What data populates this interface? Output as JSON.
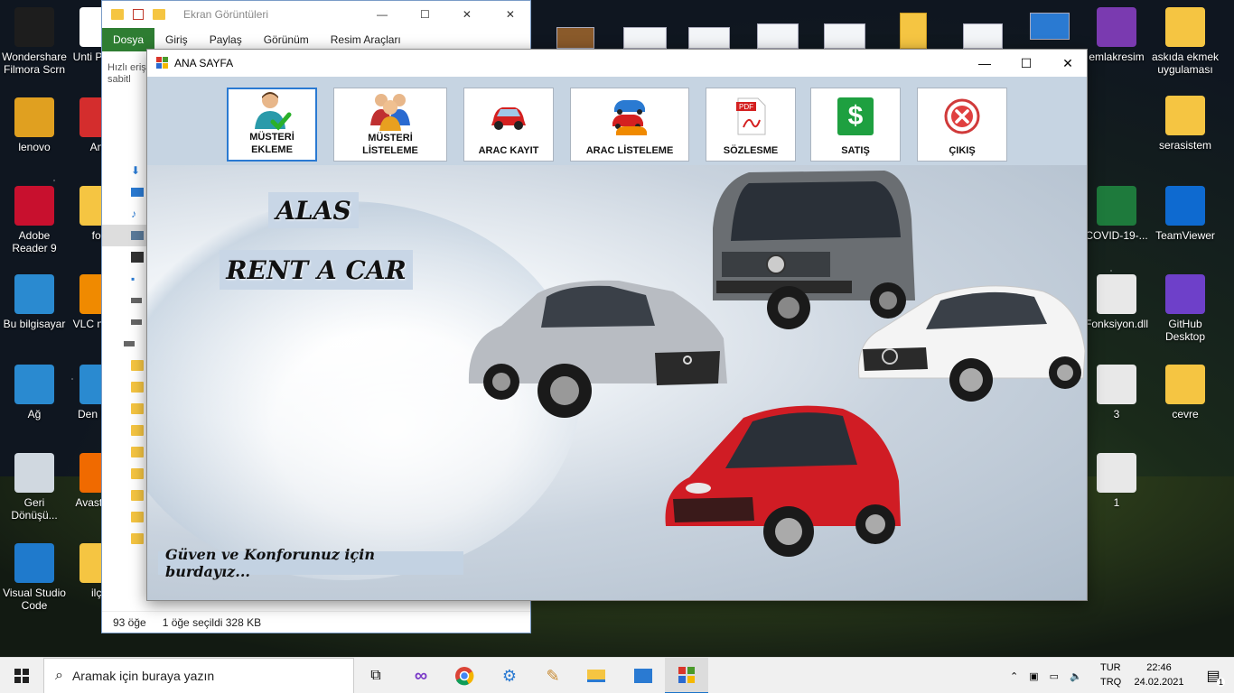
{
  "desktop": {
    "icons_left": [
      {
        "label": "Wondershare Filmora Scrn",
        "color": "#1d1d1d",
        "glyph": "filmora-icon"
      },
      {
        "label": "lenovo",
        "color": "#e0a020",
        "glyph": "user-folder-icon"
      },
      {
        "label": "Adobe Reader 9",
        "color": "#c8102e",
        "glyph": "adobe-reader-icon"
      },
      {
        "label": "Bu bilgisayar",
        "color": "#2a8ad0",
        "glyph": "computer-icon"
      },
      {
        "label": "Ağ",
        "color": "#2a8ad0",
        "glyph": "network-icon"
      },
      {
        "label": "Geri Dönüşü...",
        "color": "#d0d8e0",
        "glyph": "recycle-bin-icon"
      },
      {
        "label": "Visual Studio Code",
        "color": "#1f7acc",
        "glyph": "vscode-icon"
      }
    ],
    "icons_left2": [
      {
        "label": "Unti Projec",
        "color": "#ffffff"
      },
      {
        "label": "Any",
        "color": "#d42d2d"
      },
      {
        "label": "fori",
        "color": "#f5c542"
      },
      {
        "label": "VLC n play",
        "color": "#f08a00"
      },
      {
        "label": "Den Mas",
        "color": "#2a8ad0"
      },
      {
        "label": "Avast Anti",
        "color": "#f06a00"
      },
      {
        "label": "ilçe",
        "color": "#f5c542"
      }
    ],
    "icons_right": [
      {
        "label": "emlakresim",
        "color": "#7a3ab0"
      },
      {
        "label": "askıda ekmek uygulaması",
        "color": "#f5c542"
      },
      {
        "label": "serasistem",
        "color": "#f5c542"
      },
      {
        "label": "COVID-19-...",
        "color": "#1e7a3c"
      },
      {
        "label": "TeamViewer",
        "color": "#0e6ad0"
      },
      {
        "label": "Fonksiyon.dll",
        "color": "#e8e8e8"
      },
      {
        "label": "GitHub Desktop",
        "color": "#6e40c9"
      },
      {
        "label": "3",
        "color": "#e8e8e8"
      },
      {
        "label": "cevre",
        "color": "#f5c542"
      },
      {
        "label": "1",
        "color": "#e8e8e8"
      }
    ]
  },
  "explorer": {
    "title": "Ekran Görüntüleri",
    "tabs": [
      "Dosya",
      "Giriş",
      "Paylaş",
      "Görünüm",
      "Resim Araçları"
    ],
    "quick_access": "Hızlı eriş sabitl",
    "status_items": "93 öğe",
    "status_selected": "1 öğe seçildi  328 KB"
  },
  "app": {
    "title": "ANA SAYFA",
    "buttons": [
      {
        "label": "MÜSTERİ EKLEME"
      },
      {
        "label": "MÜSTERİ LİSTELEME"
      },
      {
        "label": "ARAC KAYIT"
      },
      {
        "label": "ARAC LİSTELEME"
      },
      {
        "label": "SÖZLESME"
      },
      {
        "label": "SATIŞ"
      },
      {
        "label": "ÇIKIŞ"
      }
    ],
    "brand_line1": "ALAS",
    "brand_line2": "RENT A CAR",
    "slogan": "Güven ve Konforunuz  için burdayız...",
    "pdf_text": "PDF",
    "dollar_text": "$"
  },
  "taskbar": {
    "search_placeholder": "Aramak için buraya yazın",
    "lang1": "TUR",
    "lang2": "TRQ",
    "time": "22:46",
    "date": "24.02.2021",
    "notification_count": "1"
  }
}
